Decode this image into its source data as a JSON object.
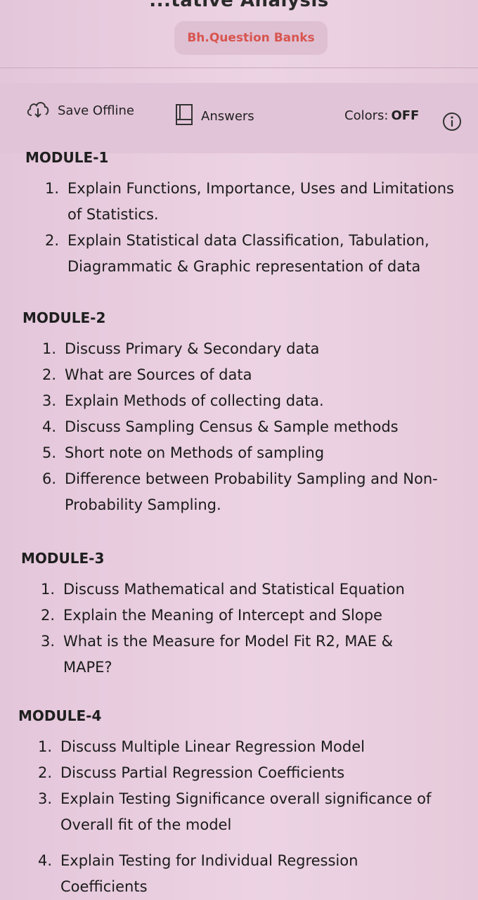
{
  "header": {
    "partial_title": "...tative Analysis",
    "bank_label": "Bh.Question Banks"
  },
  "toolbar": {
    "save_offline": "Save Offline",
    "answers": "Answers",
    "colors_label": "Colors:",
    "colors_value": "OFF"
  },
  "modules": [
    {
      "title": "MODULE-1",
      "questions": [
        {
          "num": "1.",
          "text": "Explain Functions, Importance, Uses and Limitations of Statistics."
        },
        {
          "num": "2.",
          "text": "Explain Statistical data Classification, Tabulation, Diagrammatic & Graphic representation of data"
        }
      ]
    },
    {
      "title": "MODULE-2",
      "questions": [
        {
          "num": "1.",
          "text": "Discuss Primary & Secondary data"
        },
        {
          "num": "2.",
          "text": "What are Sources of data"
        },
        {
          "num": "3.",
          "text": "Explain Methods of collecting data."
        },
        {
          "num": "4.",
          "text": "Discuss Sampling Census & Sample methods"
        },
        {
          "num": "5.",
          "text": "Short note on Methods of sampling"
        },
        {
          "num": "6.",
          "text": "Difference between Probability Sampling and Non-Probability Sampling."
        }
      ]
    },
    {
      "title": "MODULE-3",
      "questions": [
        {
          "num": "1.",
          "text": "Discuss Mathematical and Statistical Equation"
        },
        {
          "num": "2.",
          "text": "Explain the Meaning of Intercept and Slope"
        },
        {
          "num": "3.",
          "text": "What is the Measure for Model Fit R2, MAE & MAPE?"
        }
      ]
    },
    {
      "title": "MODULE-4",
      "questions": [
        {
          "num": "1.",
          "text": "Discuss Multiple Linear Regression Model"
        },
        {
          "num": "2.",
          "text": "Discuss Partial Regression Coefficients"
        },
        {
          "num": "3.",
          "text": "Explain Testing Significance overall significance of Overall fit of the model"
        },
        {
          "num": "4.",
          "text": "Explain Testing for Individual Regression Coefficients"
        }
      ]
    }
  ],
  "icons": {
    "save": "cloud-download-icon",
    "answers": "book-icon",
    "info": "info-icon"
  }
}
